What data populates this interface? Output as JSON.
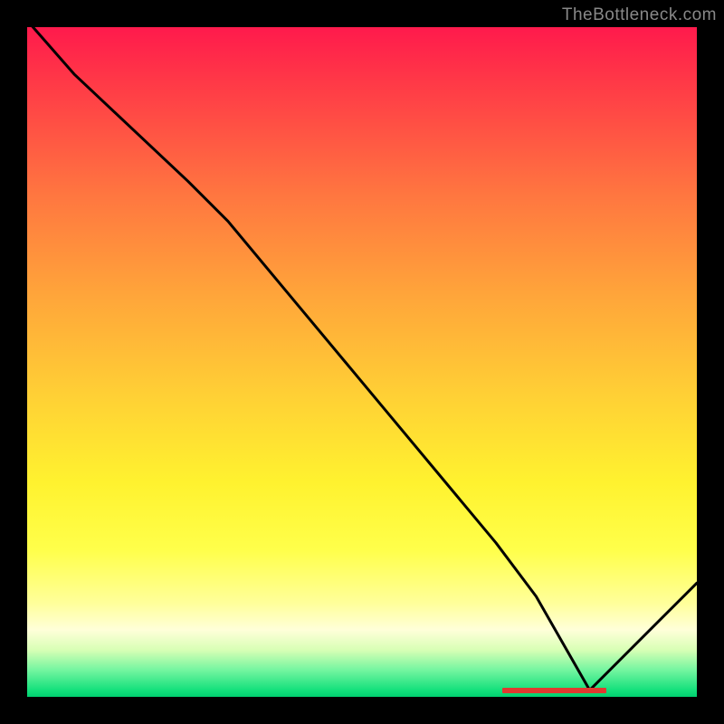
{
  "watermark": "TheBottleneck.com",
  "chart_data": {
    "type": "line",
    "title": "",
    "xlabel": "",
    "ylabel": "",
    "xlim": [
      0,
      100
    ],
    "ylim": [
      0,
      100
    ],
    "grid": false,
    "legend": false,
    "background_gradient": [
      "#ff1a4c",
      "#ff7640",
      "#ffd035",
      "#ffff4a",
      "#ffffd9",
      "#14e07c"
    ],
    "series": [
      {
        "name": "bottleneck-curve",
        "x": [
          0,
          7,
          24,
          30,
          40,
          50,
          60,
          70,
          76,
          84,
          90,
          95,
          100
        ],
        "values": [
          101,
          93,
          77,
          71,
          59,
          47,
          35,
          23,
          15,
          1,
          7,
          12,
          17
        ]
      }
    ],
    "annotations": [
      {
        "name": "optimal-range-marker",
        "x_start": 71,
        "x_end": 86,
        "y": 1,
        "color": "#e03a30"
      }
    ]
  }
}
